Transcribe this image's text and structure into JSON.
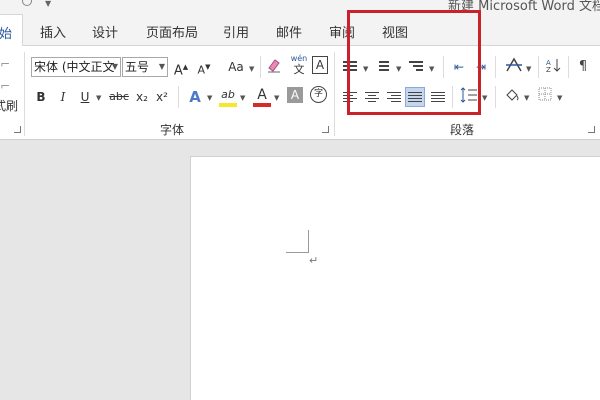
{
  "window": {
    "title": "新建 Microsoft Word 文档"
  },
  "tabs": [
    {
      "label": "始"
    },
    {
      "label": "插入"
    },
    {
      "label": "设计"
    },
    {
      "label": "页面布局"
    },
    {
      "label": "引用"
    },
    {
      "label": "邮件"
    },
    {
      "label": "审阅"
    },
    {
      "label": "视图"
    }
  ],
  "clipboard": {
    "partial_label": "式刷"
  },
  "font": {
    "group_label": "字体",
    "font_name": "宋体 (中文正文",
    "font_size": "五号",
    "grow_label": "A",
    "shrink_label": "A",
    "case_label": "Aa",
    "phonetic_top": "wén",
    "phonetic_bottom": "文",
    "border_label": "A",
    "bold": "B",
    "italic": "I",
    "underline": "U",
    "strike": "abc",
    "subscript": "x₂",
    "superscript": "x²",
    "effects": "A",
    "highlight": "ab",
    "color": "A",
    "shading": "A",
    "enclose": "字"
  },
  "paragraph": {
    "group_label": "段落"
  },
  "colors": {
    "tab_active": "#2b579a",
    "highlight_box": "#c9222b",
    "font_color_bar": "#d62b2b",
    "highlight_bar": "#f7e72a"
  }
}
